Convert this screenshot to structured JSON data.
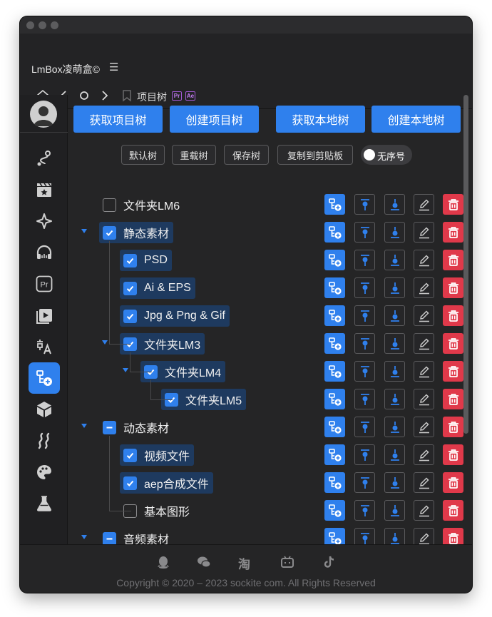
{
  "app": {
    "name": "LmBox凌萌盒©",
    "breadcrumb": "项目树",
    "tag_pr": "Pr",
    "tag_ae": "Ae"
  },
  "sidebar": {
    "items": [
      {
        "icon": "route-icon"
      },
      {
        "icon": "clapperboard-icon"
      },
      {
        "icon": "sparkle-icon"
      },
      {
        "icon": "headphones-icon"
      },
      {
        "icon": "premiere-icon",
        "text": "Pr"
      },
      {
        "icon": "video-play-icon"
      },
      {
        "icon": "translate-icon"
      },
      {
        "icon": "project-tree-icon",
        "active": true
      },
      {
        "icon": "cube-icon"
      },
      {
        "icon": "wave-icon"
      },
      {
        "icon": "palette-icon"
      },
      {
        "icon": "flask-icon"
      }
    ]
  },
  "toolbar": {
    "get_project_tree": "获取项目树",
    "create_project_tree": "创建项目树",
    "get_local_tree": "获取本地树",
    "create_local_tree": "创建本地树",
    "default_tree": "默认树",
    "reload_tree": "重载树",
    "save_tree": "保存树",
    "copy_to_clipboard": "复制到剪贴板",
    "no_order_toggle": "无序号"
  },
  "tree": [
    {
      "label": "文件夹LM6",
      "level": 0,
      "check": "off",
      "caret": false,
      "selected": false
    },
    {
      "label": "静态素材",
      "level": 0,
      "check": "on",
      "caret": true,
      "selected": true
    },
    {
      "label": "PSD",
      "level": 1,
      "check": "on",
      "caret": false,
      "selected": true
    },
    {
      "label": "Ai & EPS",
      "level": 1,
      "check": "on",
      "caret": false,
      "selected": true
    },
    {
      "label": "Jpg & Png & Gif",
      "level": 1,
      "check": "on",
      "caret": false,
      "selected": true
    },
    {
      "label": "文件夹LM3",
      "level": 1,
      "check": "on",
      "caret": true,
      "selected": true
    },
    {
      "label": "文件夹LM4",
      "level": 2,
      "check": "on",
      "caret": true,
      "selected": true
    },
    {
      "label": "文件夹LM5",
      "level": 3,
      "check": "on",
      "caret": false,
      "selected": true
    },
    {
      "label": "动态素材",
      "level": 0,
      "check": "half",
      "caret": true,
      "selected": false
    },
    {
      "label": "视频文件",
      "level": 1,
      "check": "on",
      "caret": false,
      "selected": true
    },
    {
      "label": "aep合成文件",
      "level": 1,
      "check": "on",
      "caret": false,
      "selected": true
    },
    {
      "label": "基本图形",
      "level": 1,
      "check": "off",
      "caret": false,
      "selected": false
    },
    {
      "label": "音频素材",
      "level": 0,
      "check": "half",
      "caret": true,
      "selected": false
    }
  ],
  "row_actions": [
    "add-subfolder-icon",
    "pin-up-icon",
    "pin-down-icon",
    "edit-icon",
    "delete-icon"
  ],
  "footer": {
    "icons": [
      "qq-icon",
      "wechat-icon",
      "taobao-icon",
      "bilibili-icon",
      "tiktok-icon"
    ],
    "taobao_text": "淘",
    "copyright": "Copyright © 2020 – 2023 sockite com. All Rights Reserved"
  },
  "colors": {
    "accent": "#2f80ed",
    "danger": "#e0394a",
    "bg": "#252526"
  }
}
